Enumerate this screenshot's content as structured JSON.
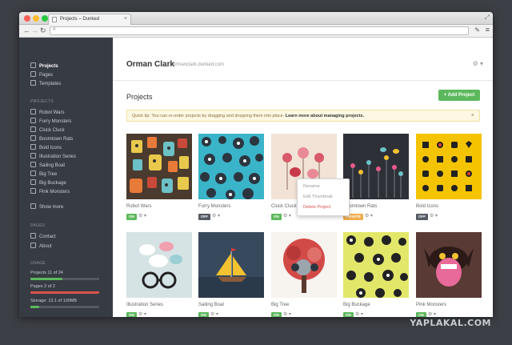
{
  "browser": {
    "tab_title": "Projects – Dunked",
    "tab_close": "×",
    "url": "",
    "colors": {
      "close": "#fc5f57",
      "minimize": "#fdbb2e",
      "zoom": "#2ac941"
    }
  },
  "sidebar": {
    "nav": [
      {
        "label": "Projects",
        "icon": "grid-icon"
      },
      {
        "label": "Pages",
        "icon": "page-icon"
      },
      {
        "label": "Templates",
        "icon": "template-icon"
      }
    ],
    "projects_header": "PROJECTS",
    "projects": [
      "Robot Wars",
      "Furry Monsters",
      "Cluck Cluck",
      "Boomtown Rats",
      "Bold Icons",
      "Illustration Series",
      "Sailing Boat",
      "Big Tree",
      "Big Buckage",
      "Pink Monsters"
    ],
    "show_more": "Show more",
    "pages_header": "PAGES",
    "pages": [
      "Contact",
      "About"
    ],
    "usage_header": "USAGE",
    "usage": [
      {
        "label": "Projects 11 of 24",
        "fraction": 0.46,
        "color": "#5cb85c"
      },
      {
        "label": "Pages 2 of 2",
        "fraction": 1.0,
        "color": "#d9534f"
      },
      {
        "label": "Storage: 13.1 of 100MB",
        "fraction": 0.13,
        "color": "#5cb85c"
      }
    ]
  },
  "header": {
    "user_name": "Orman Clark",
    "user_site": "ormanclark.dunked.com"
  },
  "main": {
    "title": "Projects",
    "add_button": "+ Add Project",
    "tip_text": "Quick tip: You can re-order projects by dragging and dropping them into place. ",
    "tip_link": "Learn more about managing projects.",
    "tip_close": "×",
    "cards": [
      {
        "name": "Robot Wars",
        "status": "ON",
        "status_color": "#5cb85c",
        "thumb": "robot-wars-thumbnail"
      },
      {
        "name": "Furry Monsters",
        "status": "OFF",
        "status_color": "#555b63",
        "thumb": "furry-monsters-thumbnail"
      },
      {
        "name": "Cluck Cluck",
        "status": "ON",
        "status_color": "#5cb85c",
        "thumb": "cluck-cluck-thumbnail"
      },
      {
        "name": "Boomtown Rats",
        "status": "PRIVATE",
        "status_color": "#f0ad4e",
        "thumb": "boomtown-rats-thumbnail"
      },
      {
        "name": "Bold Icons",
        "status": "OFF",
        "status_color": "#555b63",
        "thumb": "bold-icons-thumbnail"
      },
      {
        "name": "Illustration Series",
        "status": "ON",
        "status_color": "#5cb85c",
        "thumb": "illustration-series-thumbnail"
      },
      {
        "name": "Sailing Boat",
        "status": "ON",
        "status_color": "#5cb85c",
        "thumb": "sailing-boat-thumbnail"
      },
      {
        "name": "Big Tree",
        "status": "ON",
        "status_color": "#5cb85c",
        "thumb": "big-tree-thumbnail"
      },
      {
        "name": "Big Buckage",
        "status": "ON",
        "status_color": "#5cb85c",
        "thumb": "big-buckage-thumbnail"
      },
      {
        "name": "Pink Monsters",
        "status": "ON",
        "status_color": "#5cb85c",
        "thumb": "pink-monsters-thumbnail"
      }
    ],
    "dropdown": [
      "Rename",
      "Edit Thumbnail",
      "Delete Project"
    ]
  },
  "watermark": "YAPLAKAL.COM"
}
